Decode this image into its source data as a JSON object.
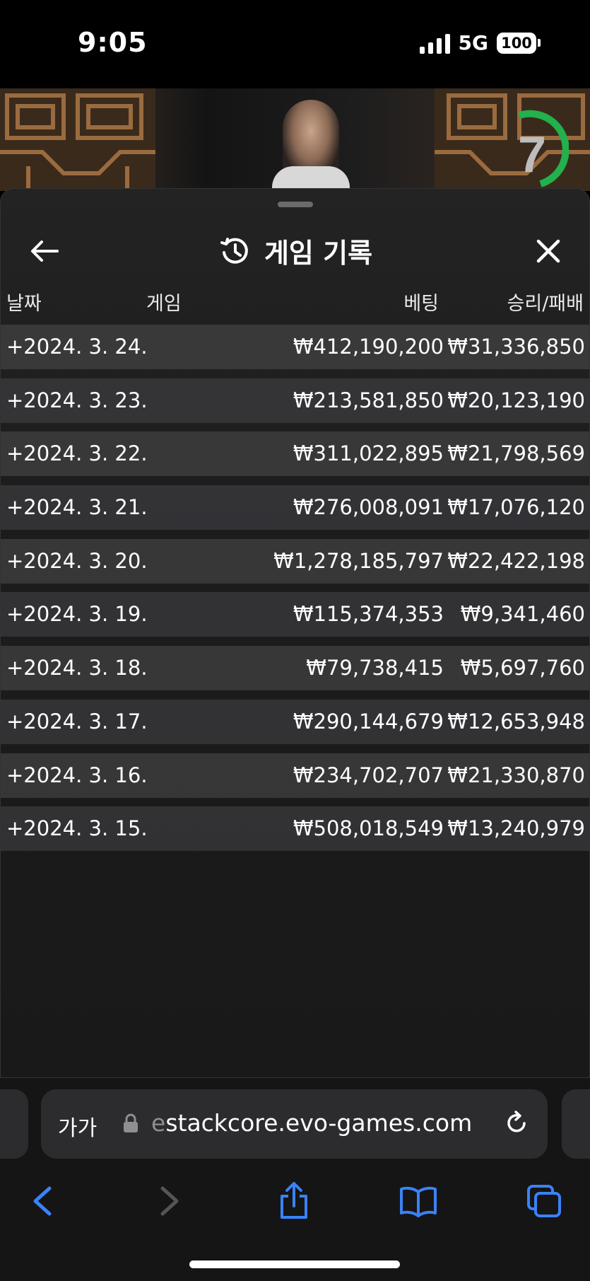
{
  "status_bar": {
    "time": "9:05",
    "network": "5G",
    "battery": "100"
  },
  "video": {
    "timer_value": "7",
    "timer_color": "#22b14c"
  },
  "panel": {
    "title": "게임 기록",
    "columns": {
      "date": "날짜",
      "game": "게임",
      "bet": "베팅",
      "win_loss": "승리/패배"
    },
    "rows": [
      {
        "date": "+2024. 3. 24.",
        "bet": "₩412,190,200",
        "win": "₩31,336,850"
      },
      {
        "date": "+2024. 3. 23.",
        "bet": "₩213,581,850",
        "win": "₩20,123,190"
      },
      {
        "date": "+2024. 3. 22.",
        "bet": "₩311,022,895",
        "win": "₩21,798,569"
      },
      {
        "date": "+2024. 3. 21.",
        "bet": "₩276,008,091",
        "win": "₩17,076,120"
      },
      {
        "date": "+2024. 3. 20.",
        "bet": "₩1,278,185,797",
        "win": "₩22,422,198"
      },
      {
        "date": "+2024. 3. 19.",
        "bet": "₩115,374,353",
        "win": "₩9,341,460"
      },
      {
        "date": "+2024. 3. 18.",
        "bet": "₩79,738,415",
        "win": "₩5,697,760"
      },
      {
        "date": "+2024. 3. 17.",
        "bet": "₩290,144,679",
        "win": "₩12,653,948"
      },
      {
        "date": "+2024. 3. 16.",
        "bet": "₩234,702,707",
        "win": "₩21,330,870"
      },
      {
        "date": "+2024. 3. 15.",
        "bet": "₩508,018,549",
        "win": "₩13,240,979"
      }
    ]
  },
  "browser": {
    "text_size_label": "가가",
    "url_faded": "e",
    "url": "stackcore.evo-games.com",
    "accent_color": "#3a82f7"
  }
}
